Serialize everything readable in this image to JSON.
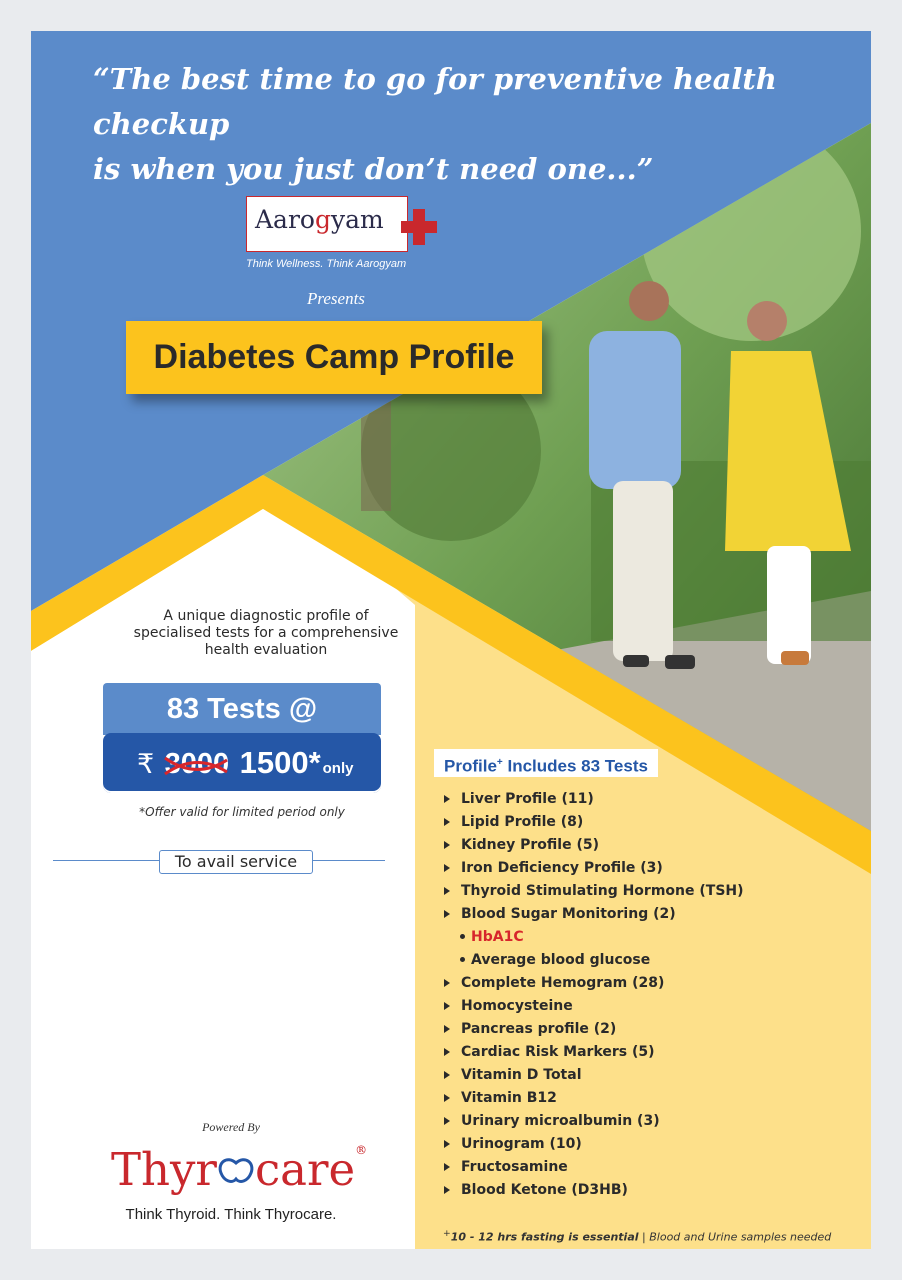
{
  "quote": {
    "line1": "“The best time to go for preventive health checkup",
    "line2": "is when you just don’t need one...”"
  },
  "brand": {
    "name_part1": "Aaro",
    "name_part2": "g",
    "name_part3": "yam",
    "tagline": "Think Wellness. Think Aarogyam",
    "presents": "Presents"
  },
  "banner": {
    "title": "Diabetes Camp Profile"
  },
  "intro": {
    "line1": "A unique diagnostic profile of",
    "line2": "specialised tests for a comprehensive",
    "line3": "health evaluation"
  },
  "pricing": {
    "tests_label": "83 Tests @",
    "currency": "₹",
    "old_price": "3000",
    "new_price": "1500*",
    "only": "only",
    "offer_note": "*Offer valid for limited period only"
  },
  "avail": {
    "label": "To avail service"
  },
  "profile": {
    "heading": "Profile",
    "heading_sup": "+",
    "heading_rest": " Includes 83 Tests",
    "items": [
      {
        "text": "Liver Profile (11)",
        "kind": "arrow"
      },
      {
        "text": "Lipid Profile (8)",
        "kind": "arrow"
      },
      {
        "text": "Kidney Profile (5)",
        "kind": "arrow"
      },
      {
        "text": "Iron Deficiency Profile (3)",
        "kind": "arrow"
      },
      {
        "text": "Thyroid Stimulating Hormone (TSH)",
        "kind": "arrow"
      },
      {
        "text": "Blood Sugar Monitoring (2)",
        "kind": "arrow"
      },
      {
        "text": "HbA1C",
        "kind": "dot",
        "highlight": true
      },
      {
        "text": "Average blood glucose",
        "kind": "dot"
      },
      {
        "text": "Complete Hemogram (28)",
        "kind": "arrow"
      },
      {
        "text": "Homocysteine",
        "kind": "arrow"
      },
      {
        "text": "Pancreas profile (2)",
        "kind": "arrow"
      },
      {
        "text": "Cardiac Risk Markers (5)",
        "kind": "arrow"
      },
      {
        "text": "Vitamin D Total",
        "kind": "arrow"
      },
      {
        "text": "Vitamin B12",
        "kind": "arrow"
      },
      {
        "text": "Urinary microalbumin (3)",
        "kind": "arrow"
      },
      {
        "text": "Urinogram (10)",
        "kind": "arrow"
      },
      {
        "text": "Fructosamine",
        "kind": "arrow"
      },
      {
        "text": "Blood Ketone (D3HB)",
        "kind": "arrow"
      }
    ],
    "footnote_mark": "+",
    "footnote_bold": "10 - 12 hrs fasting is essential",
    "footnote_rest": " | Blood and Urine samples needed"
  },
  "powered": {
    "label": "Powered By",
    "logo_part1": "Thyr",
    "logo_part2": "care",
    "logo_reg": "®",
    "tagline": "Think Thyroid. Think Thyrocare."
  },
  "colors": {
    "blue": "#5b8bca",
    "dark_blue": "#2557a7",
    "yellow": "#fcc31d",
    "light_yellow": "#fde08a",
    "red": "#c9282d"
  }
}
